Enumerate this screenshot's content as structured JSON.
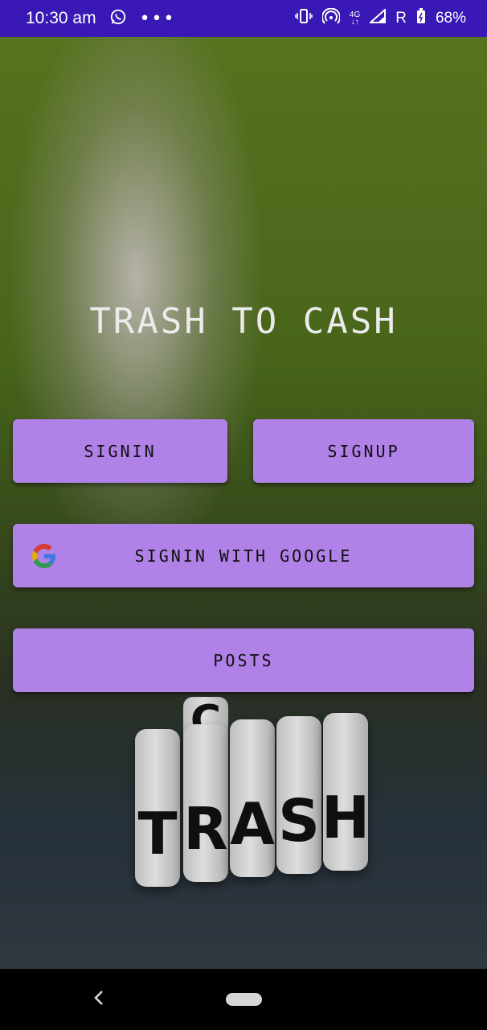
{
  "status_bar": {
    "time": "10:30 am",
    "overflow": "•••",
    "network_type": "4G",
    "roaming": "R",
    "battery": "68%"
  },
  "app": {
    "title": "TRASH TO CASH",
    "buttons": {
      "signin": "SIGNIN",
      "signup": "SIGNUP",
      "google": "SIGNIN WITH GOOGLE",
      "posts": "POSTS"
    },
    "background_dice_letters": [
      "T",
      "R",
      "A",
      "S",
      "H"
    ],
    "background_dice_top_letter": "C"
  },
  "colors": {
    "status_bar": "#3a18b5",
    "button": "#bf8dfa",
    "title_text": "#ffffff"
  },
  "icons": [
    "whatsapp-icon",
    "vibrate-icon",
    "hotspot-icon",
    "signal-icon",
    "battery-icon",
    "google-icon",
    "back-icon",
    "home-pill-icon"
  ]
}
